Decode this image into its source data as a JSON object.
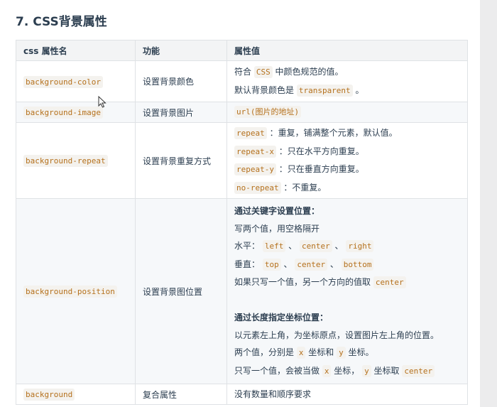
{
  "heading": "7. CSS背景属性",
  "table": {
    "headers": [
      "css 属性名",
      "功能",
      "属性值"
    ],
    "rows": [
      {
        "name": "background-color",
        "func": "设置背景颜色",
        "values": [
          [
            {
              "t": "符合 "
            },
            {
              "c": "CSS"
            },
            {
              "t": " 中颜色规范的值。"
            }
          ],
          [
            {
              "t": "默认背景颜色是 "
            },
            {
              "c": "transparent"
            },
            {
              "t": " 。"
            }
          ]
        ]
      },
      {
        "name": "background-image",
        "func": "设置背景图片",
        "values": [
          [
            {
              "c": "url(图片的地址)"
            }
          ]
        ]
      },
      {
        "name": "background-repeat",
        "func": "设置背景重复方式",
        "values": [
          [
            {
              "c": "repeat"
            },
            {
              "t": " ：重复，铺满整个元素，默认值。"
            }
          ],
          [
            {
              "c": "repeat-x"
            },
            {
              "t": " ：只在水平方向重复。"
            }
          ],
          [
            {
              "c": "repeat-y"
            },
            {
              "t": " ：只在垂直方向重复。"
            }
          ],
          [
            {
              "c": "no-repeat"
            },
            {
              "t": " ：不重复。"
            }
          ]
        ]
      },
      {
        "name": "background-position",
        "func": "设置背景图位置",
        "values": [
          [
            {
              "b": "通过关键字设置位置："
            }
          ],
          [
            {
              "t": "写两个值，用空格隔开"
            }
          ],
          [
            {
              "t": "水平： "
            },
            {
              "c": "left"
            },
            {
              "t": " 、 "
            },
            {
              "c": "center"
            },
            {
              "t": " 、 "
            },
            {
              "c": "right"
            }
          ],
          [
            {
              "t": "垂直： "
            },
            {
              "c": "top"
            },
            {
              "t": " 、 "
            },
            {
              "c": "center"
            },
            {
              "t": " 、 "
            },
            {
              "c": "bottom"
            }
          ],
          [
            {
              "t": "如果只写一个值，另一个方向的值取 "
            },
            {
              "c": "center"
            }
          ],
          [],
          [
            {
              "b": "通过长度指定坐标位置："
            }
          ],
          [
            {
              "t": "以元素左上角，为坐标原点，设置图片左上角的位置。"
            }
          ],
          [
            {
              "t": "两个值，分别是 "
            },
            {
              "c": "x"
            },
            {
              "t": " 坐标和 "
            },
            {
              "c": "y"
            },
            {
              "t": " 坐标。"
            }
          ],
          [
            {
              "t": "只写一个值，会被当做 "
            },
            {
              "c": "x"
            },
            {
              "t": " 坐标， "
            },
            {
              "c": "y"
            },
            {
              "t": " 坐标取 "
            },
            {
              "c": "center"
            }
          ]
        ]
      },
      {
        "name": "background",
        "func": "复合属性",
        "values": [
          [
            {
              "t": "没有数量和顺序要求"
            }
          ]
        ]
      }
    ]
  },
  "colors": {
    "code_text": "#b5711d",
    "code_bg": "#f4f2ee",
    "border": "#dfe2e5",
    "header_bg": "#f3f4f5",
    "text": "#2c3e50"
  }
}
